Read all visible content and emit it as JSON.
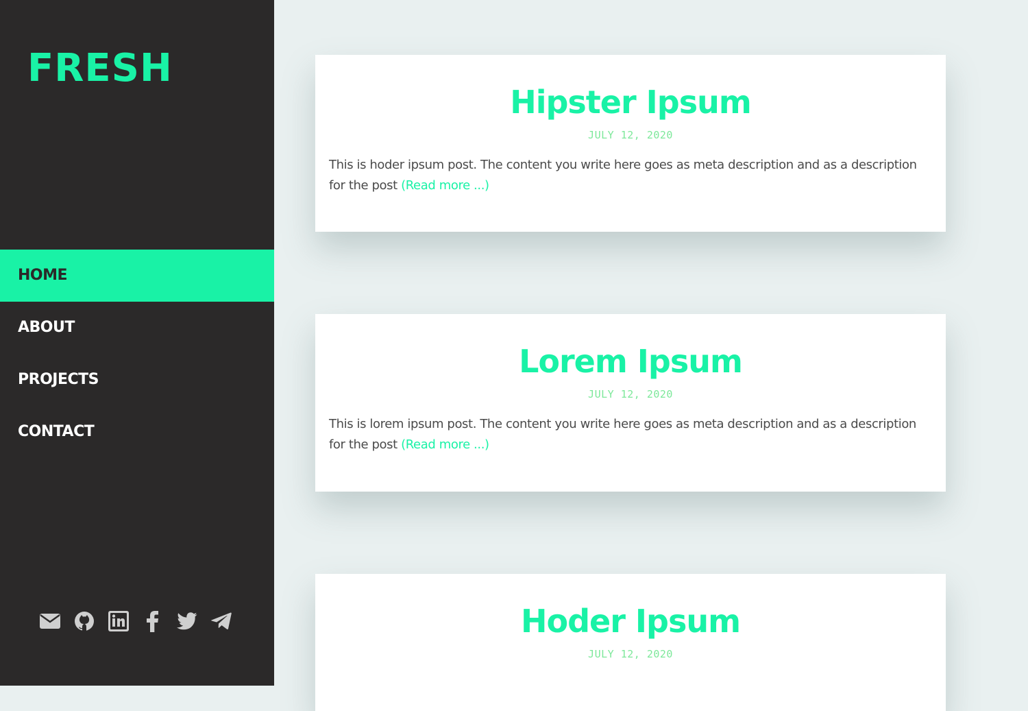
{
  "site": {
    "logo": "FRESH"
  },
  "nav": {
    "items": [
      {
        "label": "HOME",
        "active": true
      },
      {
        "label": "ABOUT",
        "active": false
      },
      {
        "label": "PROJECTS",
        "active": false
      },
      {
        "label": "CONTACT",
        "active": false
      }
    ]
  },
  "socials": [
    "mail-icon",
    "github-icon",
    "linkedin-icon",
    "facebook-icon",
    "twitter-icon",
    "telegram-icon"
  ],
  "posts": [
    {
      "title": "Hipster Ipsum",
      "date": "JULY 12, 2020",
      "body": "This is hoder ipsum post. The content you write here goes as meta description and as a description for the post",
      "read_more": "(Read more ...)"
    },
    {
      "title": "Lorem Ipsum",
      "date": "JULY 12, 2020",
      "body": "This is lorem ipsum post. The content you write here goes as meta description and as a description for the post",
      "read_more": "(Read more ...)"
    },
    {
      "title": "Hoder Ipsum",
      "date": "JULY 12, 2020",
      "body": "",
      "read_more": ""
    }
  ],
  "colors": {
    "accent": "#19f2a6",
    "sidebar": "#2b2929",
    "background": "#e9f0f0",
    "date": "#7de89a",
    "icon": "#cfcfcf"
  }
}
